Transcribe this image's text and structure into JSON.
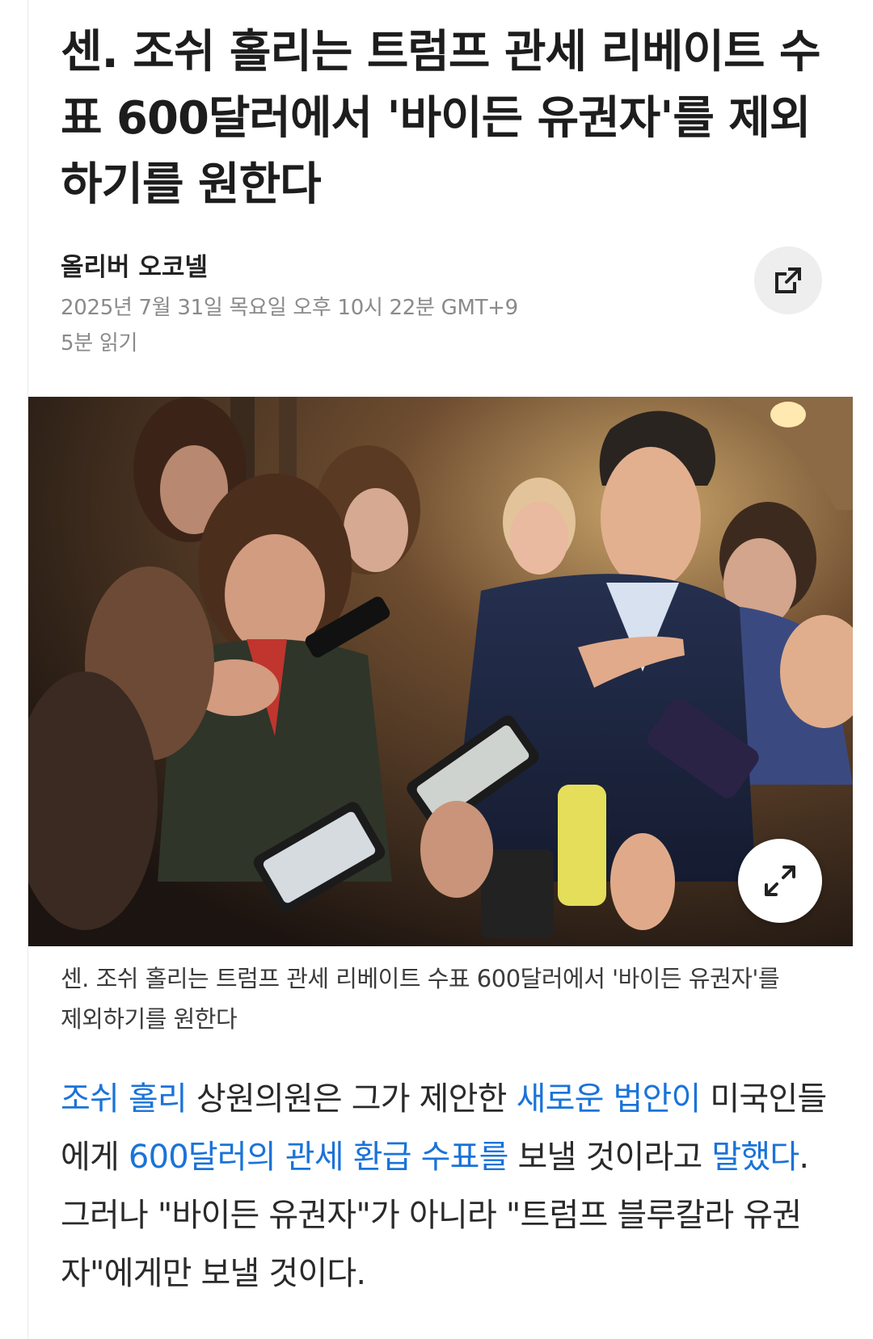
{
  "article": {
    "title": "센. 조쉬 홀리는 트럼프 관세 리베이트 수표 600달러에서 '바이든 유권자'를 제외하기를 원한다",
    "author": "올리버 오코넬",
    "date": "2025년 7월 31일 목요일 오후 10시 22분 GMT+9",
    "read_time": "5분 읽기",
    "share_icon": "external-link-icon",
    "expand_icon": "expand-arrows-icon",
    "image_caption": "센. 조쉬 홀리는 트럼프 관세 리베이트 수표 600달러에서 '바이든 유권자'를 제외하기를 원한다",
    "body": {
      "link_1": "조쉬 홀리",
      "text_1": " 상원의원은 그가 제안한 ",
      "link_2": "새로운 법안이",
      "text_2": " 미국인들에게 ",
      "link_3": "600달러의 관세 환급 수표를",
      "text_3": " 보낼 것이라고 ",
      "link_4": "말했다",
      "text_4": ". 그러나 \"바이든 유권자\"가 아니라 \"트럼프 블루칼라 유권자\"에게만 보낼 것이다."
    }
  },
  "colors": {
    "link": "#1a73d9",
    "meta": "#8a8a8a",
    "title": "#1d1d1d"
  }
}
